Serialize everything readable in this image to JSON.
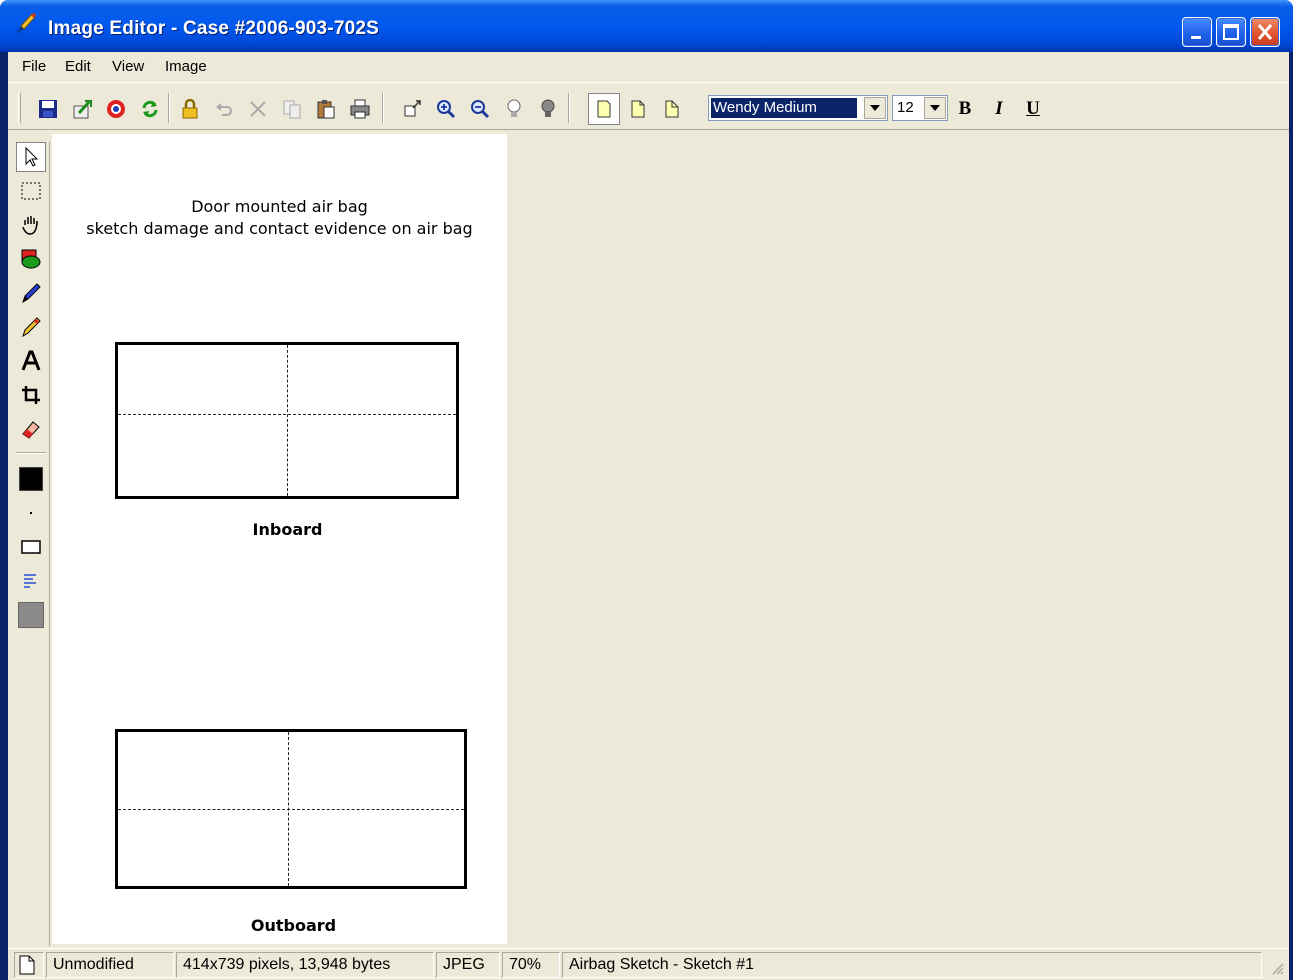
{
  "window": {
    "title": "Image Editor - Case #2006-903-702S",
    "controls": [
      "minimize",
      "maximize",
      "close"
    ]
  },
  "menu": [
    "File",
    "Edit",
    "View",
    "Image"
  ],
  "toolbar": {
    "buttons": [
      "save-icon",
      "export-icon",
      "help-icon",
      "refresh-icon",
      "lock-icon",
      "undo-icon",
      "cut-icon",
      "copy-icon",
      "paste-icon",
      "print-icon",
      "fit-icon",
      "zoom-in-icon",
      "zoom-out-icon",
      "lightbulb-off-icon",
      "lightbulb-on-icon",
      "page-icon",
      "page-fold-icon",
      "page-corner-icon"
    ],
    "font_name": "Wendy Medium",
    "font_size": "12",
    "bold_label": "B",
    "italic_label": "I",
    "underline_label": "U"
  },
  "tools": [
    "pointer-icon",
    "select-rect-icon",
    "hand-icon",
    "shape-icon",
    "pen-icon",
    "pencil-icon",
    "text-tool-icon",
    "crop-icon",
    "eraser-icon",
    "color-swatch",
    "dot-size",
    "rectangle-icon",
    "align-icon",
    "fill-swatch"
  ],
  "canvas": {
    "heading_line1": "Door mounted air bag",
    "heading_line2": "sketch damage and contact evidence on air bag",
    "label_top": "Inboard",
    "label_bottom": "Outboard"
  },
  "status": {
    "state": "Unmodified",
    "dimensions": "414x739 pixels, 13,948 bytes",
    "format": "JPEG",
    "zoom": "70%",
    "name": "Airbag Sketch - Sketch #1"
  },
  "colors": {
    "title_blue": "#0058ee",
    "face": "#ece9d8",
    "selection": "#0a246a"
  }
}
